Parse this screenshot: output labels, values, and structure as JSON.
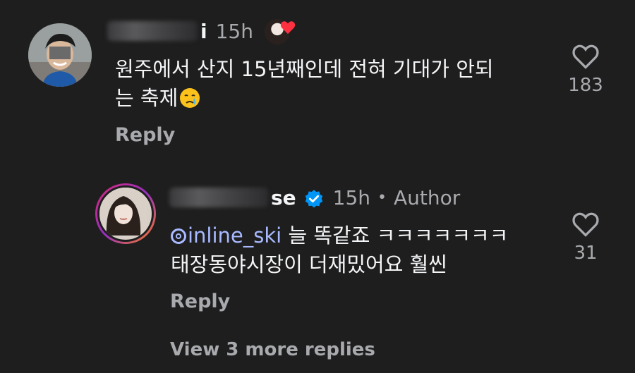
{
  "comments": [
    {
      "name_tail": "i",
      "time": "15h",
      "text_line1": "원주에서 산지 15년째인데 전혀 기대가 안되",
      "text_line2": "는 축제",
      "emoji": "crying-face",
      "reply_label": "Reply",
      "likes": "183",
      "liked_by_author": true
    },
    {
      "name_tail": "se",
      "time": "15h",
      "author_label": "Author",
      "verified": true,
      "mention": "inline_ski",
      "text_line1": " 늘 똑같죠 ㅋㅋㅋㅋㅋㅋㅋ",
      "text_line2": "태장동야시장이 더재밌어요 훨씬",
      "reply_label": "Reply",
      "likes": "31",
      "view_more": "View 3 more replies"
    }
  ],
  "colors": {
    "background": "#1e1e1f",
    "text_primary": "#f3f5f7",
    "text_secondary": "#a8aaad",
    "mention": "#a8b9ff",
    "verified": "#0095f6",
    "heart_liked": "#ff3040"
  }
}
